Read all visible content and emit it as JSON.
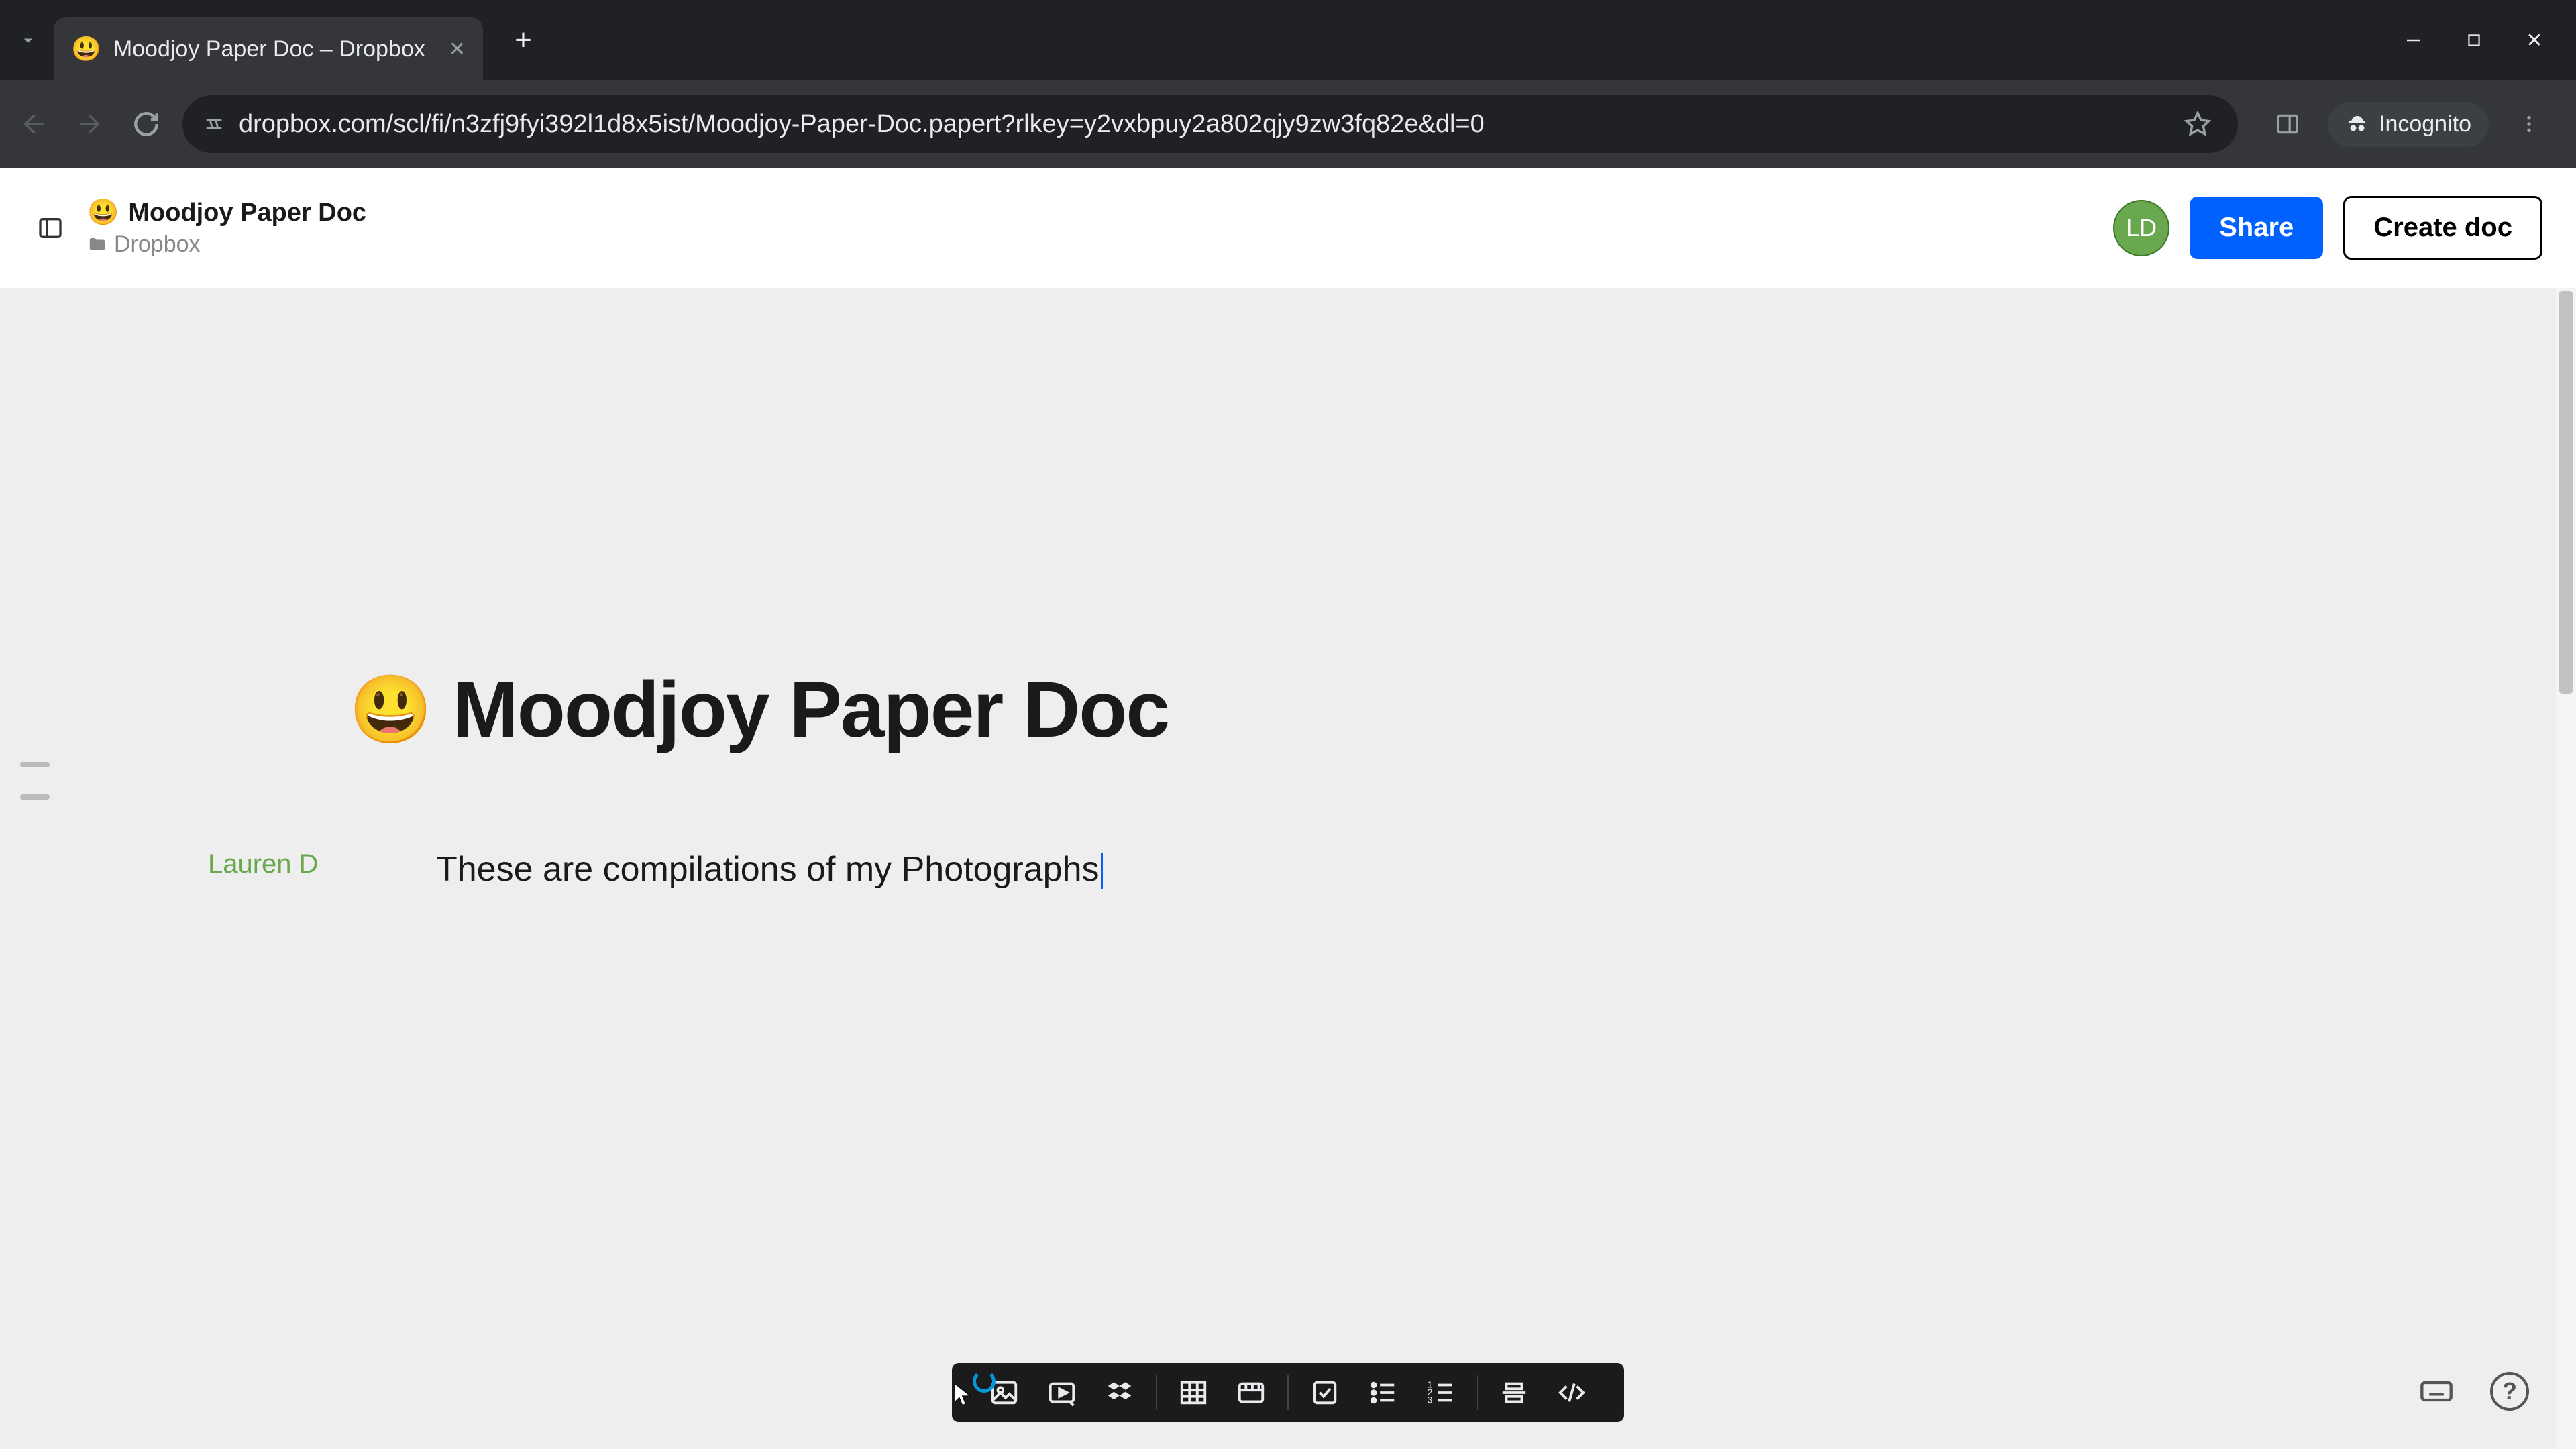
{
  "browser": {
    "tab_title": "Moodjoy Paper Doc – Dropbox",
    "url": "dropbox.com/scl/fi/n3zfj9fyi392l1d8x5ist/Moodjoy-Paper-Doc.papert?rlkey=y2vxbpuy2a802qjy9zw3fq82e&dl=0",
    "incognito_label": "Incognito"
  },
  "header": {
    "doc_title": "Moodjoy Paper Doc",
    "breadcrumb": "Dropbox",
    "avatar_initials": "LD",
    "share_label": "Share",
    "create_doc_label": "Create doc"
  },
  "document": {
    "emoji": "😃",
    "title": "Moodjoy Paper Doc",
    "author": "Lauren D",
    "body_text": "These are compilations of my Photographs"
  },
  "toolbar_icons": [
    "image-icon",
    "video-icon",
    "dropbox-icon",
    "table-icon",
    "timeline-icon",
    "checklist-icon",
    "bulleted-list-icon",
    "numbered-list-icon",
    "divider-icon",
    "code-icon"
  ],
  "colors": {
    "primary_blue": "#0061fe",
    "avatar_green": "#6aa84f"
  }
}
